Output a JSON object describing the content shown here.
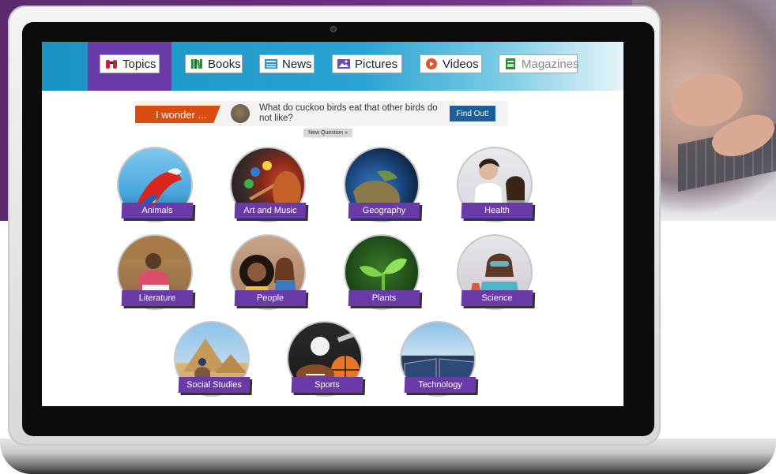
{
  "nav": {
    "tabs": [
      {
        "label": "Topics",
        "icon": "binoculars-icon",
        "active": true
      },
      {
        "label": "Books",
        "icon": "books-icon",
        "active": false
      },
      {
        "label": "News",
        "icon": "newspaper-icon",
        "active": false
      },
      {
        "label": "Pictures",
        "icon": "picture-icon",
        "active": false
      },
      {
        "label": "Videos",
        "icon": "play-icon",
        "active": false
      },
      {
        "label": "Magazines",
        "icon": "magazine-icon",
        "active": false
      }
    ]
  },
  "wonder": {
    "label": "I wonder ...",
    "question": "What do cuckoo birds eat that other birds do not like?",
    "button": "Find Out!",
    "new_question": "New Question »"
  },
  "topics": [
    {
      "label": "Animals"
    },
    {
      "label": "Art and Music"
    },
    {
      "label": "Geography"
    },
    {
      "label": "Health"
    },
    {
      "label": "Literature"
    },
    {
      "label": "People"
    },
    {
      "label": "Plants"
    },
    {
      "label": "Science"
    },
    {
      "label": "Social Studies"
    },
    {
      "label": "Sports"
    },
    {
      "label": "Technology"
    }
  ],
  "colors": {
    "nav_blue": "#1a93c4",
    "active_purple": "#6a3aa8",
    "wonder_orange": "#d94e10",
    "button_blue": "#1d5d98"
  }
}
